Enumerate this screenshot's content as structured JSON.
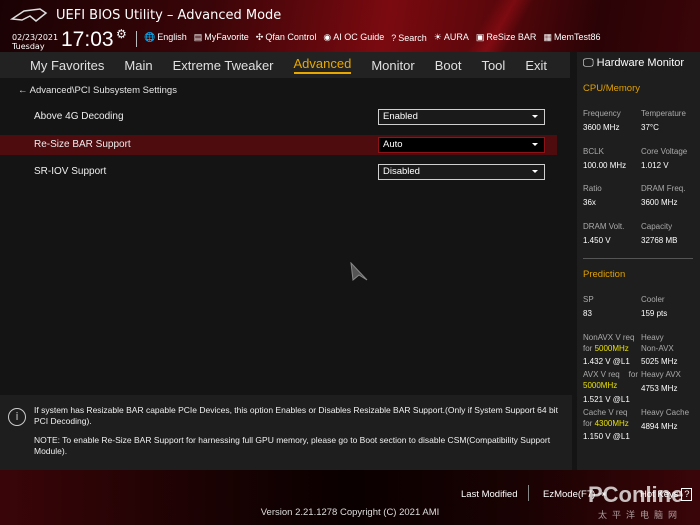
{
  "header": {
    "title": "UEFI BIOS Utility – Advanced Mode",
    "date": "02/23/2021",
    "day": "Tuesday",
    "time": "17:03",
    "tools": [
      {
        "icon": "globe-icon",
        "glyph": "🌐",
        "label": "English"
      },
      {
        "icon": "favorite-icon",
        "glyph": "▤",
        "label": "MyFavorite"
      },
      {
        "icon": "fan-icon",
        "glyph": "✣",
        "label": "Qfan Control"
      },
      {
        "icon": "ai-oc-icon",
        "glyph": "◉",
        "label": "AI OC Guide"
      },
      {
        "icon": "search-icon",
        "glyph": "?",
        "label": "Search"
      },
      {
        "icon": "aura-icon",
        "glyph": "☀",
        "label": "AURA"
      },
      {
        "icon": "resize-bar-icon",
        "glyph": "▣",
        "label": "ReSize BAR"
      },
      {
        "icon": "memtest-icon",
        "glyph": "▦",
        "label": "MemTest86"
      }
    ]
  },
  "nav": {
    "tabs": [
      "My Favorites",
      "Main",
      "Extreme Tweaker",
      "Advanced",
      "Monitor",
      "Boot",
      "Tool",
      "Exit"
    ],
    "active": "Advanced"
  },
  "main": {
    "breadcrumb": "Advanced\\PCI Subsystem Settings",
    "settings": [
      {
        "label": "Above 4G Decoding",
        "value": "Enabled"
      },
      {
        "label": "Re-Size BAR Support",
        "value": "Auto"
      },
      {
        "label": "SR-IOV Support",
        "value": "Disabled"
      }
    ]
  },
  "hw": {
    "title": "Hardware Monitor",
    "section1": "CPU/Memory",
    "cpu": [
      {
        "label": "Frequency",
        "value": "3600 MHz"
      },
      {
        "label": "Temperature",
        "value": "37°C"
      },
      {
        "label": "BCLK",
        "value": "100.00 MHz"
      },
      {
        "label": "Core Voltage",
        "value": "1.012 V"
      },
      {
        "label": "Ratio",
        "value": "36x"
      },
      {
        "label": "DRAM Freq.",
        "value": "3600 MHz"
      },
      {
        "label": "DRAM Volt.",
        "value": "1.450 V"
      },
      {
        "label": "Capacity",
        "value": "32768 MB"
      }
    ],
    "section2": "Prediction",
    "sp": {
      "label": "SP",
      "value": "83"
    },
    "cooler": {
      "label": "Cooler",
      "value": "159 pts"
    },
    "nonavx": {
      "l1": "NonAVX V req",
      "l2": "for ",
      "freq": "5000MHz",
      "value": "1.432 V @L1"
    },
    "avx": {
      "l1": "AVX V req    for",
      "freq": "5000MHz",
      "value": "1.521 V @L1"
    },
    "cache": {
      "l1": "Cache V req",
      "l2": "for ",
      "freq": "4300MHz",
      "value": "1.150 V @L1"
    },
    "heavy_nonavx": {
      "l1": "Heavy",
      "l2": "Non-AVX",
      "value": "5025 MHz"
    },
    "heavy_avx": {
      "l1": "Heavy AVX",
      "value": "4753 MHz"
    },
    "heavy_cache": {
      "l1": "Heavy Cache",
      "value": "4894 MHz"
    }
  },
  "info": {
    "line1": "If system has Resizable BAR capable PCIe Devices, this option Enables or Disables Resizable BAR Support.(Only if System Support 64 bit PCI Decoding).",
    "line2": "NOTE: To enable Re-Size BAR Support for harnessing full GPU memory, please go to Boot section to disable CSM(Compatibility Support Module)."
  },
  "footer": {
    "last_modified": "Last Modified",
    "ezmode": "EzMode(F7)",
    "hotkeys": "Hot Keys",
    "hotkeys_key": "?",
    "version": "Version 2.21.1278 Copyright (C) 2021 AMI"
  },
  "watermark": {
    "text": "PConline",
    "sub": "太平洋电脑网"
  }
}
